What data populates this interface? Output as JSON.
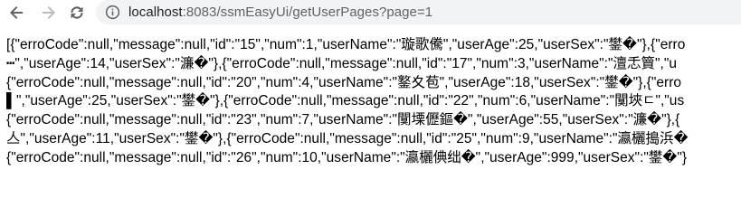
{
  "browser": {
    "url_host": "localhost",
    "url_rest": ":8083/ssmEasyUi/getUserPages?page=1"
  },
  "page": {
    "lines": [
      "[{\"erroCode\":null,\"message\":null,\"id\":\"15\",\"num\":1,\"userName\":\"璇歌儯\",\"userAge\":25,\"userSex\":\"鐢�\"},{\"erro",
      "┅\",\"userAge\":14,\"userSex\":\"濂�\"},{\"erroCode\":null,\"message\":null,\"id\":\"17\",\"num\":3,\"userName\":\"澶忎簤\",\"u",
      "{\"erroCode\":null,\"message\":null,\"id\":\"20\",\"num\":4,\"userName\":\"鐜夊苞\",\"userAge\":18,\"userSex\":\"鐢�\"},{\"erro",
      "▌\",\"userAge\":25,\"userSex\":\"鐢�\"},{\"erroCode\":null,\"message\":null,\"id\":\"22\",\"num\":6,\"userName\":\"闃埉ㄷ\",\"us",
      "{\"erroCode\":null,\"message\":null,\"id\":\"23\",\"num\":7,\"userName\":\"闃塛儮鏂�\",\"userAge\":55,\"userSex\":\"濂�\"},{",
      "亼\",\"userAge\":11,\"userSex\":\"鐢�\"},{\"erroCode\":null,\"message\":null,\"id\":\"25\",\"num\":9,\"userName\":\"瀛欐搗浜�",
      "{\"erroCode\":null,\"message\":null,\"id\":\"26\",\"num\":10,\"userName\":\"瀛欐倎绌�\",\"userAge\":999,\"userSex\":\"鐢�\"}"
    ]
  },
  "colors": {
    "omnibox_bg": "#f1f3f4",
    "icon": "#5f6368",
    "text": "#000000"
  },
  "icons": {
    "back": "arrow-left-icon",
    "forward": "arrow-right-icon",
    "reload": "reload-icon",
    "info": "info-icon"
  }
}
